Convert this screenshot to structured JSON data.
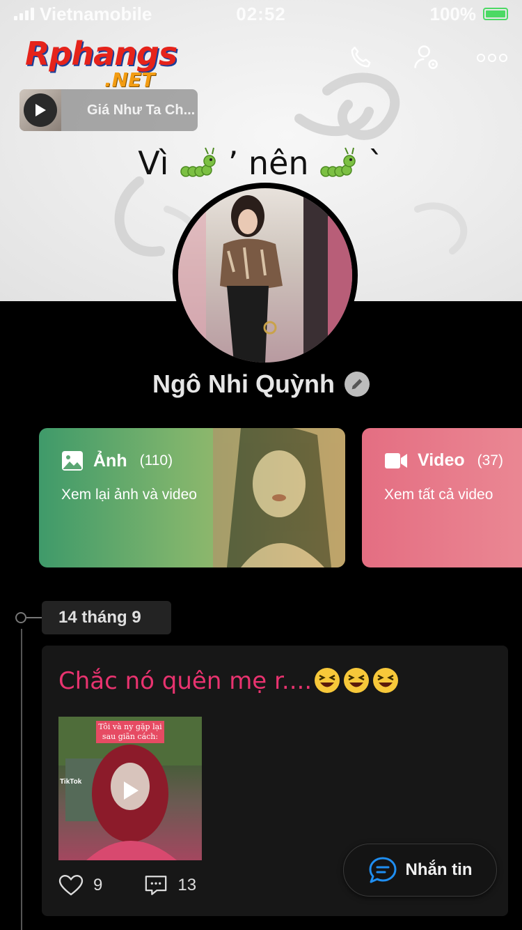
{
  "status_bar": {
    "carrier": "Vietnamobile",
    "time": "02:52",
    "battery": "100%"
  },
  "logo": {
    "main": "Rphangs",
    "sub": ".NET"
  },
  "music": {
    "title": "Giá Như Ta Ch..."
  },
  "profile": {
    "status_left": "Vì",
    "status_middle": "’ nên",
    "status_right": "`",
    "name": "Ngô Nhi Quỳnh"
  },
  "media": {
    "photos": {
      "title": "Ảnh",
      "count": "(110)",
      "subtitle": "Xem lại ảnh và video"
    },
    "videos": {
      "title": "Video",
      "count": "(37)",
      "subtitle": "Xem tất cả video"
    }
  },
  "timeline": {
    "date": "14 tháng 9",
    "post": {
      "text": "Chắc nó quên mẹ r....",
      "thumbnail_caption": "Tôi và ny gặp lại sau giãn cách:",
      "thumbnail_watermark": "TikTok",
      "likes": "9",
      "comments": "13"
    }
  },
  "message_button": {
    "label": "Nhắn tin"
  },
  "icons": [
    "call-icon",
    "profile-settings-icon",
    "more-icon",
    "play-icon",
    "photo-icon",
    "video-camera-icon",
    "heart-icon",
    "comment-icon",
    "chat-icon",
    "edit-icon"
  ],
  "colors": {
    "accent_pink": "#e8336f",
    "photos_card": "#3f9a6a",
    "videos_card": "#e46e82",
    "battery": "#4cd964"
  }
}
